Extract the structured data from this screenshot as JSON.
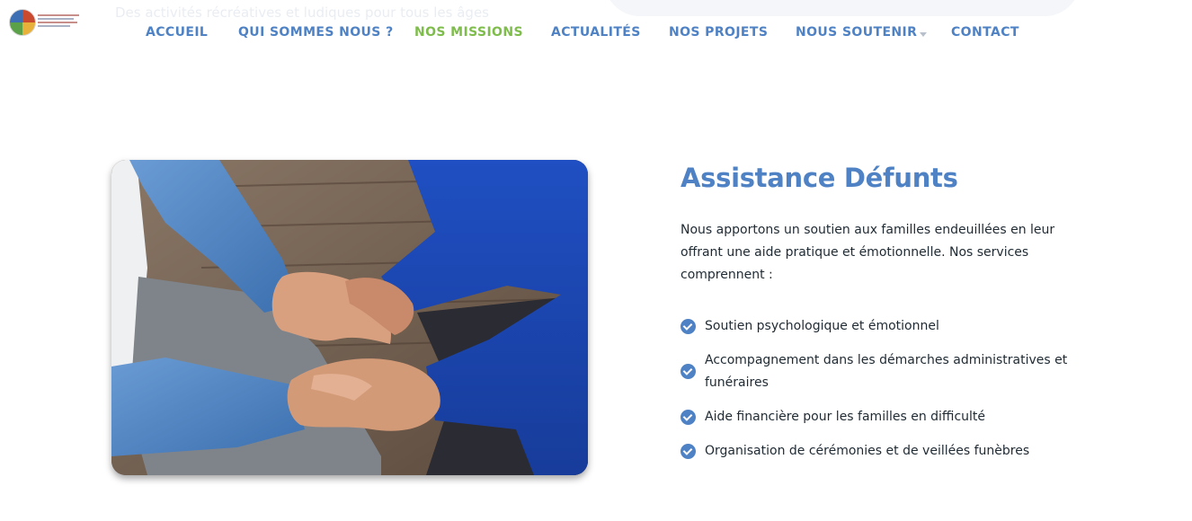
{
  "background_text": "Des activités récréatives et ludiques pour tous les âges",
  "nav": {
    "items": [
      {
        "label": "ACCUEIL"
      },
      {
        "label": "QUI SOMMES NOUS ?"
      },
      {
        "label": "NOS MISSIONS",
        "active": true
      },
      {
        "label": "ACTUALITÉS"
      },
      {
        "label": "NOS PROJETS"
      },
      {
        "label": "NOUS SOUTENIR",
        "has_dropdown": true
      },
      {
        "label": "CONTACT"
      }
    ],
    "color": "#4e82c4",
    "active_color": "#7ebd4b"
  },
  "section": {
    "image_icon": "hands-comfort-photo",
    "title": "Assistance Défunts",
    "description": "Nous apportons un soutien aux familles endeuillées en leur offrant une aide pratique et émotionnelle. Nos services comprennent :",
    "features": [
      "Soutien psychologique et émotionnel",
      "Accompagnement dans les démarches administratives et funéraires",
      "Aide financière pour les familles en difficulté",
      "Organisation de cérémonies et de veillées funèbres"
    ],
    "check_icon": "check-circle-icon"
  }
}
